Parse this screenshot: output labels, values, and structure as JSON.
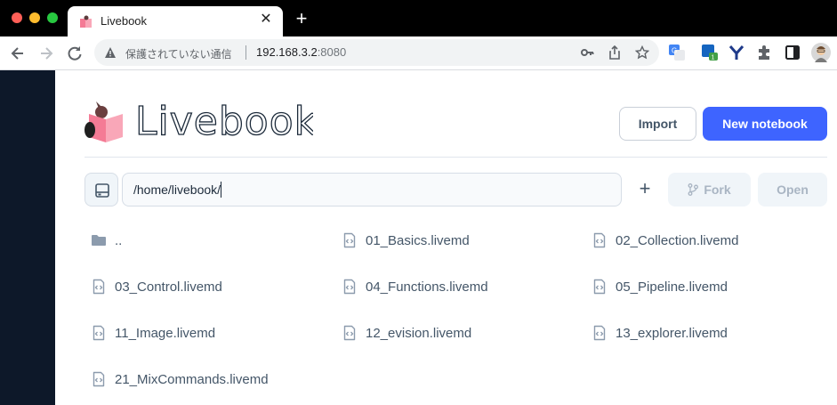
{
  "browser": {
    "tab": {
      "title": "Livebook",
      "close_glyph": "✕"
    },
    "newtab_glyph": "+",
    "omnibox": {
      "security_label": "保護されていない通信",
      "host": "192.168.3.2",
      "port": ":8080"
    },
    "extensions": [
      "translate-icon",
      "extension-badge-icon",
      "y-extension-icon",
      "puzzle-icon",
      "sidepanel-icon",
      "profile-avatar"
    ],
    "extension_badge_count": "1"
  },
  "header": {
    "logo_text": "Livebook",
    "import_label": "Import",
    "new_notebook_label": "New notebook"
  },
  "path_bar": {
    "path": "/home/livebook/",
    "add_glyph": "+",
    "fork_label": "Fork",
    "open_label": "Open"
  },
  "files": [
    {
      "name": "..",
      "type": "folder"
    },
    {
      "name": "01_Basics.livemd",
      "type": "file"
    },
    {
      "name": "02_Collection.livemd",
      "type": "file"
    },
    {
      "name": "03_Control.livemd",
      "type": "file"
    },
    {
      "name": "04_Functions.livemd",
      "type": "file"
    },
    {
      "name": "05_Pipeline.livemd",
      "type": "file"
    },
    {
      "name": "11_Image.livemd",
      "type": "file"
    },
    {
      "name": "12_evision.livemd",
      "type": "file"
    },
    {
      "name": "13_explorer.livemd",
      "type": "file"
    },
    {
      "name": "21_MixCommands.livemd",
      "type": "file"
    }
  ],
  "colors": {
    "sidebar": "#0d1829",
    "accent": "#3e64ff",
    "logo_pink": "#f47b95"
  }
}
